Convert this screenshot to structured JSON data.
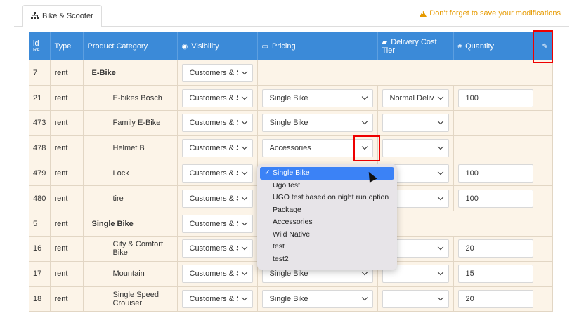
{
  "tab": {
    "label": "Bike & Scooter",
    "icon": "sitemap-icon"
  },
  "warning": {
    "text": "Don't forget to save your modifications",
    "color": "#e69a00"
  },
  "header": {
    "id_label": "id",
    "id_sub": "RA",
    "type": "Type",
    "category": "Product Category",
    "visibility": "Visibility",
    "pricing": "Pricing",
    "delivery": "Delivery Cost Tier",
    "quantity": "Quantity",
    "header_color": "#3b8ad8"
  },
  "rows": [
    {
      "id": "7",
      "type": "rent",
      "name": "E-Bike",
      "group": true,
      "visibility": "Customers & S"
    },
    {
      "id": "21",
      "type": "rent",
      "name": "E-bikes Bosch",
      "visibility": "Customers & S",
      "pricing": "Single Bike",
      "delivery": "Normal Delive",
      "quantity": "100"
    },
    {
      "id": "473",
      "type": "rent",
      "name": "Family E-Bike",
      "visibility": "Customers & S",
      "pricing": "Single Bike",
      "delivery": ""
    },
    {
      "id": "478",
      "type": "rent",
      "name": "Helmet B",
      "visibility": "Customers & S",
      "pricing": "Accessories",
      "delivery": ""
    },
    {
      "id": "479",
      "type": "rent",
      "name": "Lock",
      "visibility": "Customers & S",
      "delivery": "",
      "quantity": "100"
    },
    {
      "id": "480",
      "type": "rent",
      "name": "tire",
      "visibility": "Customers & S",
      "delivery": "",
      "quantity": "100"
    },
    {
      "id": "5",
      "type": "rent",
      "name": "Single Bike",
      "group": true,
      "visibility": "Customers & S"
    },
    {
      "id": "16",
      "type": "rent",
      "name": "City & Comfort Bike",
      "visibility": "Customers & S",
      "delivery": "",
      "quantity": "20"
    },
    {
      "id": "17",
      "type": "rent",
      "name": "Mountain",
      "visibility": "Customers & S",
      "pricing": "Single Bike",
      "delivery": "",
      "quantity": "15"
    },
    {
      "id": "18",
      "type": "rent",
      "name": "Single Speed Crouiser",
      "visibility": "Customers & S",
      "pricing": "Single Bike",
      "delivery": "",
      "quantity": "20"
    }
  ],
  "dropdown": {
    "options": [
      "Single Bike",
      "Ugo test",
      "UGO test based on night run option",
      "Package",
      "Accessories",
      "Wild Native",
      "test",
      "test2"
    ],
    "selected_index": 0,
    "check": "✓"
  }
}
